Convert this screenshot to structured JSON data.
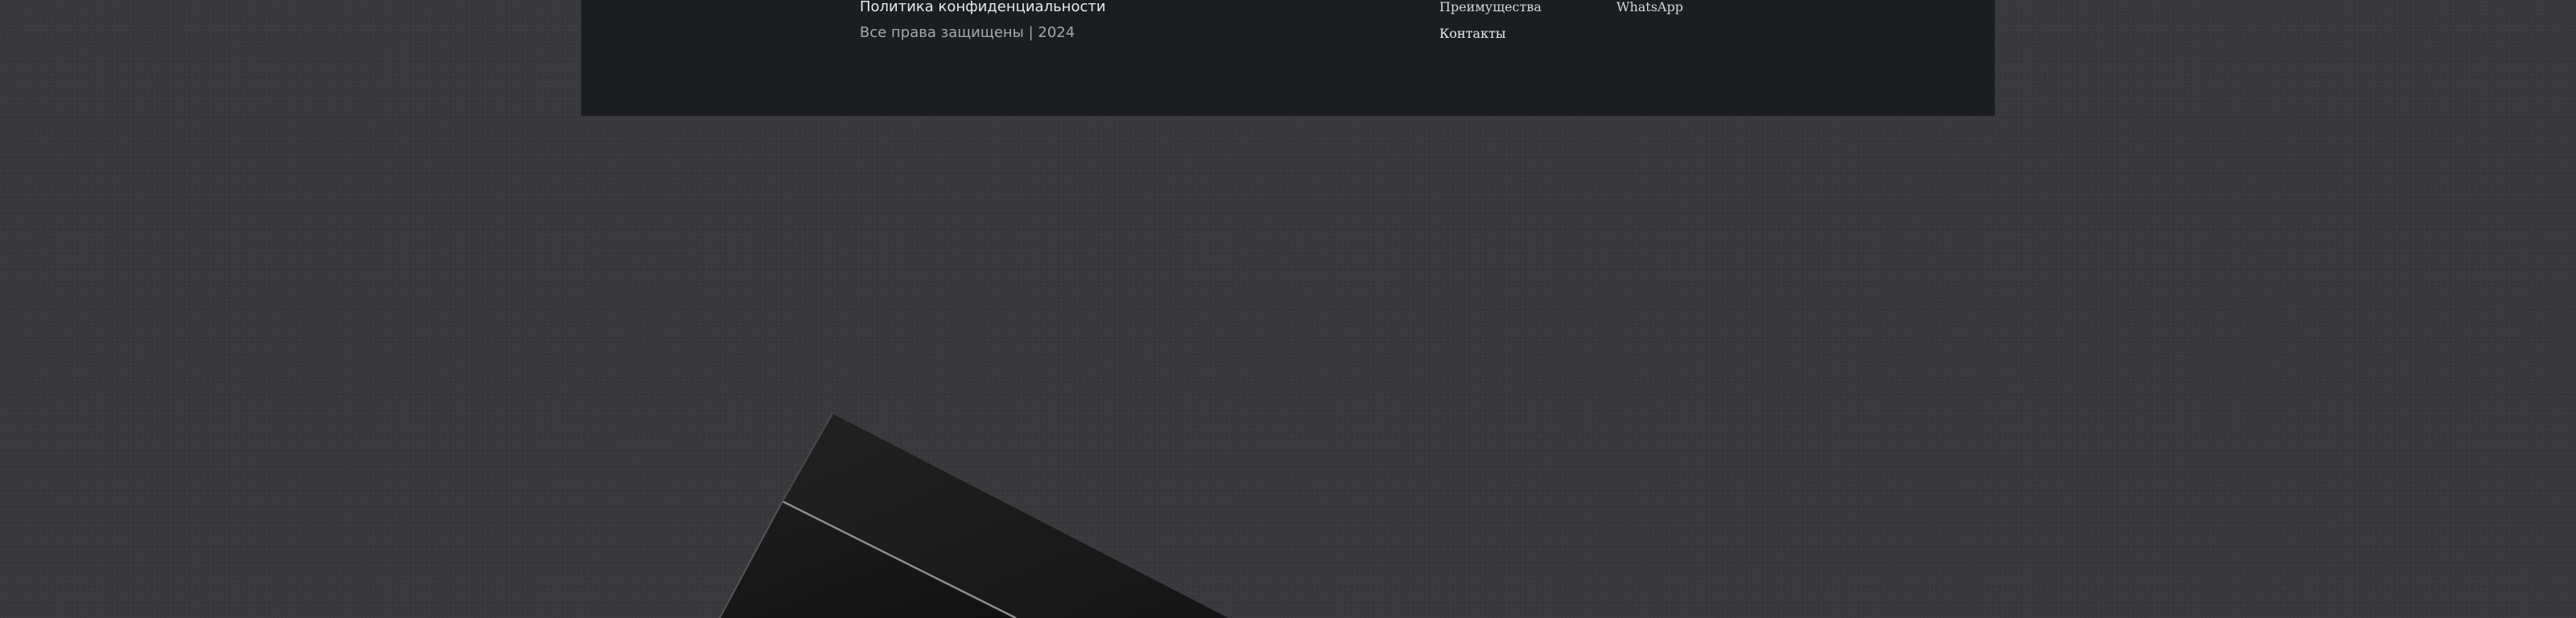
{
  "footer": {
    "privacy_policy": "Политика конфиденциальности",
    "copyright": "Все права защищены | 2024",
    "nav": {
      "advantages": "Преимущества",
      "contacts": "Контакты",
      "whatsapp": "WhatsApp"
    }
  },
  "colors": {
    "page_background": "#39393b",
    "footer_background": "#1b1d20",
    "text_primary": "#e9e9ea",
    "text_muted": "#a6a8ab"
  }
}
